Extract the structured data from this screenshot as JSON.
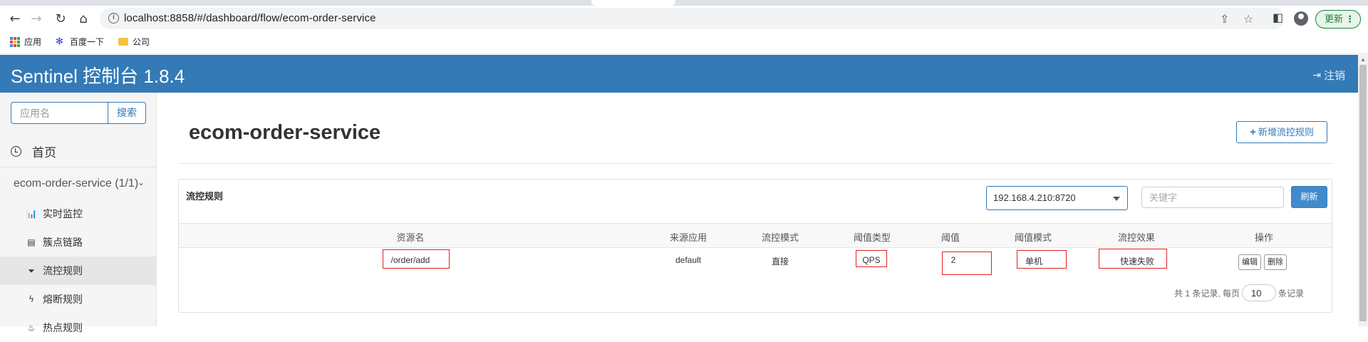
{
  "browser": {
    "url": "localhost:8858/#/dashboard/flow/ecom-order-service",
    "update_label": "更新",
    "bookmarks": [
      "应用",
      "百度一下",
      "公司"
    ]
  },
  "header": {
    "title": "Sentinel 控制台 1.8.4",
    "logout_label": "注销"
  },
  "sidebar": {
    "search_placeholder": "应用名",
    "search_button": "搜索",
    "home_label": "首页",
    "app_label": "ecom-order-service (1/1)",
    "items": [
      {
        "label": "实时监控",
        "icon": "bar-chart-icon"
      },
      {
        "label": "簇点链路",
        "icon": "list-icon"
      },
      {
        "label": "流控规则",
        "icon": "filter-icon"
      },
      {
        "label": "熔断规则",
        "icon": "flash-icon"
      },
      {
        "label": "热点规则",
        "icon": "fire-icon"
      }
    ]
  },
  "main": {
    "title": "ecom-order-service",
    "add_button": "新增流控规则",
    "panel_title": "流控规则",
    "machine_selected": "192.168.4.210:8720",
    "keyword_placeholder": "关键字",
    "refresh_button": "刷新",
    "columns": [
      "资源名",
      "来源应用",
      "流控模式",
      "阈值类型",
      "阈值",
      "阈值模式",
      "流控效果",
      "操作"
    ],
    "rows": [
      {
        "resource": "/order/add",
        "origin": "default",
        "mode": "直接",
        "grade": "QPS",
        "count": "2",
        "cluster_mode": "单机",
        "effect": "快速失败",
        "edit": "编辑",
        "delete": "删除"
      }
    ],
    "pager": {
      "prefix": "共 1 条记录, 每页",
      "page_size": "10",
      "suffix": "条记录"
    }
  },
  "colors": {
    "header_bg": "#337ab7",
    "primary": "#428bca",
    "highlight_box": "#e02020"
  }
}
